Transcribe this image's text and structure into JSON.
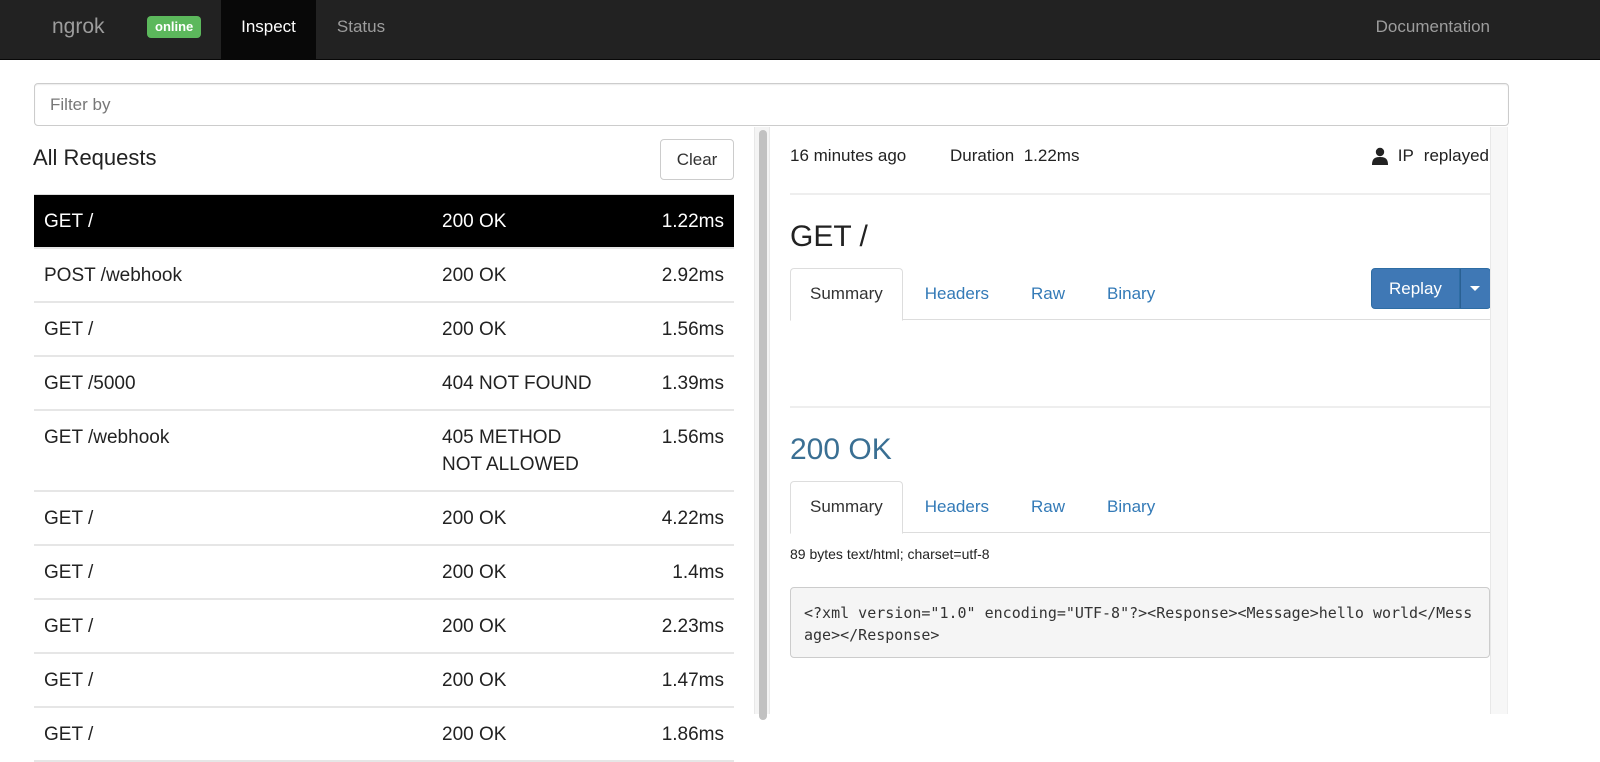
{
  "navbar": {
    "brand": "ngrok",
    "status_badge": "online",
    "tabs": [
      {
        "label": "Inspect",
        "active": true
      },
      {
        "label": "Status",
        "active": false
      }
    ],
    "docs_link": "Documentation"
  },
  "filter": {
    "placeholder": "Filter by",
    "value": ""
  },
  "requests": {
    "title": "All Requests",
    "clear_label": "Clear",
    "rows": [
      {
        "path": "GET /",
        "status": "200 OK",
        "duration": "1.22ms",
        "selected": true
      },
      {
        "path": "POST /webhook",
        "status": "200 OK",
        "duration": "2.92ms"
      },
      {
        "path": "GET /",
        "status": "200 OK",
        "duration": "1.56ms"
      },
      {
        "path": "GET /5000",
        "status": "404 NOT FOUND",
        "duration": "1.39ms"
      },
      {
        "path": "GET /webhook",
        "status": "405 METHOD NOT ALLOWED",
        "duration": "1.56ms"
      },
      {
        "path": "GET /",
        "status": "200 OK",
        "duration": "4.22ms"
      },
      {
        "path": "GET /",
        "status": "200 OK",
        "duration": "1.4ms"
      },
      {
        "path": "GET /",
        "status": "200 OK",
        "duration": "2.23ms"
      },
      {
        "path": "GET /",
        "status": "200 OK",
        "duration": "1.47ms"
      },
      {
        "path": "GET /",
        "status": "200 OK",
        "duration": "1.86ms"
      }
    ]
  },
  "detail": {
    "time_ago": "16 minutes ago",
    "duration_label": "Duration",
    "duration_value": "1.22ms",
    "ip_label": "IP",
    "replayed_label": "replayed",
    "request_title": "GET /",
    "request_tabs": [
      "Summary",
      "Headers",
      "Raw",
      "Binary"
    ],
    "replay_label": "Replay",
    "response_title": "200 OK",
    "response_tabs": [
      "Summary",
      "Headers",
      "Raw",
      "Binary"
    ],
    "response_meta": "89 bytes text/html; charset=utf-8",
    "response_body": "<?xml version=\"1.0\" encoding=\"UTF-8\"?><Response><Message>hello world</Message></Response>"
  },
  "colors": {
    "navbar_bg": "#222222",
    "badge_green": "#5cb85c",
    "link_blue": "#337ab7",
    "replay_blue": "#3f78b5",
    "response_title": "#3a6f93"
  }
}
